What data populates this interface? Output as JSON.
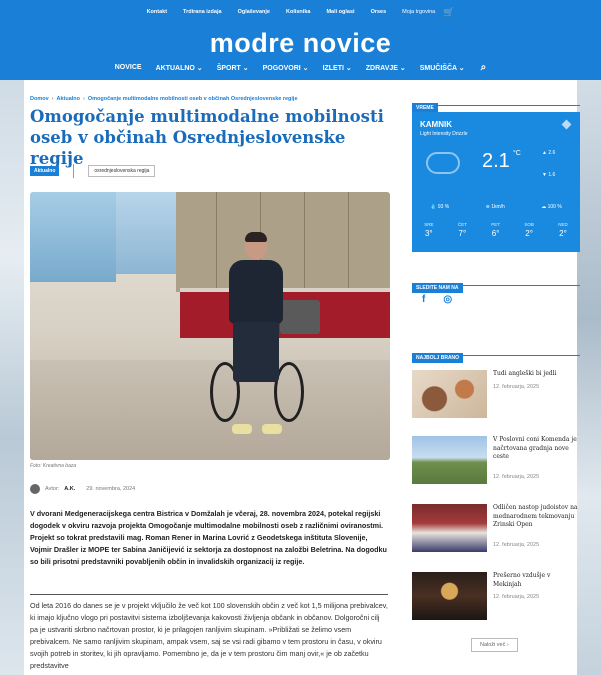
{
  "topbar": {
    "links": [
      "Kontakt",
      "Trdirana izdaja",
      "Oglaševanje",
      "Kolisnika",
      "Mali oglasi",
      "Orses",
      "Moja trgovina"
    ]
  },
  "header": {
    "logo": "modre novice",
    "nav": [
      "NOVICE",
      "AKTUALNO ⌄",
      "ŠPORT ⌄",
      "POGOVORI ⌄",
      "IZLETI ⌄",
      "ZDRAVJE ⌄",
      "SMUČIŠČA ⌄"
    ]
  },
  "breadcrumb": [
    "Domov",
    "Aktualno",
    "Omogočanje multimodalne mobilnosti oseb v občinah Osrednjeslovenske regije"
  ],
  "article": {
    "title": "Omogočanje multimodalne mobilnosti oseb v občinah Osrednjeslovenske regije",
    "category_tag": "Aktualno",
    "region_tag": "osrednjeslovenska regija",
    "photo_caption": "Foto: Kreativna baza",
    "author_label": "Avtor:",
    "author": "A.K.",
    "date": "29. novembra, 2024",
    "lead": "V dvorani Medgeneracijskega centra Bistrica v Domžalah je včeraj, 28. novembra 2024, potekal regijski dogodek v okviru razvoja projekta Omogočanje multimodalne mobilnosti oseb z različnimi oviranostmi. Projekt so tokrat predstavili mag. Roman Rener in Marina Lovrić z Geodetskega inštituta Slovenije, Vojmir Drašler iz MOPE ter Sabina Janičijević iz sektorja za dostopnost na založbi Beletrina. Na dogodku so bili prisotni predstavniki povabljenih občin in invalidskih organizacij iz regije.",
    "body": "Od leta 2016 do danes se je v projekt vključilo že več kot 100 slovenskih občin z več kot 1,5 milijona prebivalcev, ki imajo ključno vlogo pri postavitvi sistema izboljševanja kakovosti življenja občank in občanov. Dolgoročni cilj pa je ustvariti skrbno načrtovan prostor, ki je prilagojen ranljivim skupinam. »Približati se želimo vsem prebivalcem. Ne samo ranljivim skupinam, ampak vsem, saj se vsi radi gibamo v tem prostoru in času, v okviru svojih potreb in storitev, ki jih opravljamo. Pomembno je, da je v tem prostoru čim manj ovir,« je ob začetku predstavitve"
  },
  "weather": {
    "section_title": "VREME",
    "city": "KAMNIK",
    "description": "Light Intensity Drizzle",
    "temp": "2.1",
    "unit": "°C",
    "high": "2.6",
    "low": "1.6",
    "humidity": "93 %",
    "wind": "1km/h",
    "clouds": "100 %",
    "days": [
      {
        "name": "SRE",
        "temp": "3°"
      },
      {
        "name": "ČET",
        "temp": "7°"
      },
      {
        "name": "PET",
        "temp": "6°"
      },
      {
        "name": "SOB",
        "temp": "2°"
      },
      {
        "name": "NED",
        "temp": "2°"
      }
    ]
  },
  "follow": {
    "section_title": "SLEDITE NAM NA",
    "icons": [
      "f",
      "◎"
    ]
  },
  "popular": {
    "section_title": "NAJBOLJ BRANO",
    "items": [
      {
        "title": "Tudi angleški bi jedli",
        "date": "12. februarja, 2025"
      },
      {
        "title": "V Poslovni coni Komenda je načrtovana gradnja nove ceste",
        "date": "12. februarja, 2025"
      },
      {
        "title": "Odličen nastop judoistov na mednarodnem tekmovanju Zrinski Open",
        "date": "12. februarja, 2025"
      },
      {
        "title": "Prešerno vzdušje v Mekinjah",
        "date": "12. februarja, 2025"
      }
    ],
    "more_label": "Naloži več ›"
  },
  "colors": {
    "brand": "#1a7fd6",
    "title": "#1a6cbb"
  }
}
